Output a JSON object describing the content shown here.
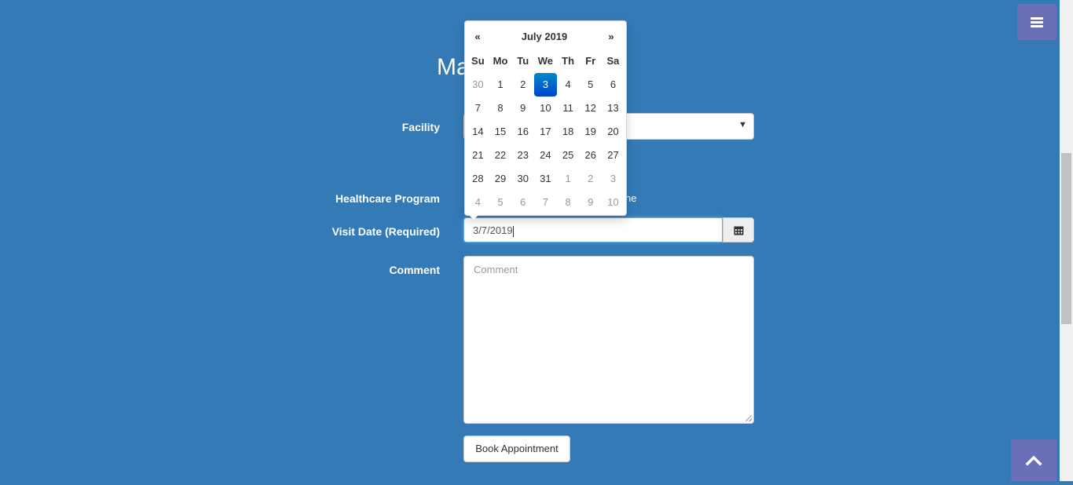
{
  "page": {
    "title_partial": "Ma"
  },
  "form": {
    "facility_label": "Facility",
    "program_label": "Healthcare Program",
    "program_option_partial": "ne",
    "visit_date_label": "Visit Date (Required)",
    "visit_date_value": "3/7/2019",
    "comment_label": "Comment",
    "comment_placeholder": "Comment",
    "book_button": "Book Appointment"
  },
  "datepicker": {
    "prev": "«",
    "next": "»",
    "month_title": "July 2019",
    "weekdays": [
      "Su",
      "Mo",
      "Tu",
      "We",
      "Th",
      "Fr",
      "Sa"
    ],
    "weeks": [
      [
        {
          "d": "30",
          "old": true
        },
        {
          "d": "1"
        },
        {
          "d": "2"
        },
        {
          "d": "3",
          "active": true
        },
        {
          "d": "4"
        },
        {
          "d": "5"
        },
        {
          "d": "6"
        }
      ],
      [
        {
          "d": "7"
        },
        {
          "d": "8"
        },
        {
          "d": "9"
        },
        {
          "d": "10"
        },
        {
          "d": "11"
        },
        {
          "d": "12"
        },
        {
          "d": "13"
        }
      ],
      [
        {
          "d": "14"
        },
        {
          "d": "15"
        },
        {
          "d": "16"
        },
        {
          "d": "17"
        },
        {
          "d": "18"
        },
        {
          "d": "19"
        },
        {
          "d": "20"
        }
      ],
      [
        {
          "d": "21"
        },
        {
          "d": "22"
        },
        {
          "d": "23"
        },
        {
          "d": "24"
        },
        {
          "d": "25"
        },
        {
          "d": "26"
        },
        {
          "d": "27"
        }
      ],
      [
        {
          "d": "28"
        },
        {
          "d": "29"
        },
        {
          "d": "30"
        },
        {
          "d": "31"
        },
        {
          "d": "1",
          "old": true
        },
        {
          "d": "2",
          "old": true
        },
        {
          "d": "3",
          "old": true
        }
      ],
      [
        {
          "d": "4",
          "old": true
        },
        {
          "d": "5",
          "old": true
        },
        {
          "d": "6",
          "old": true
        },
        {
          "d": "7",
          "old": true
        },
        {
          "d": "8",
          "old": true
        },
        {
          "d": "9",
          "old": true
        },
        {
          "d": "10",
          "old": true
        }
      ]
    ]
  },
  "icons": {
    "menu": "hamburger-icon",
    "calendar": "calendar-icon",
    "scroll_top": "chevron-up-icon"
  },
  "colors": {
    "background": "#337ab7",
    "accent_button": "#6a6fb8",
    "active_day": "#0069d9"
  }
}
